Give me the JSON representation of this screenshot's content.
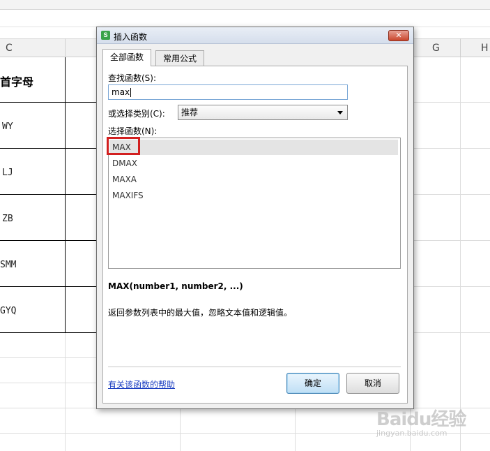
{
  "sheet": {
    "columns": [
      "C",
      "G",
      "H"
    ],
    "header_cell": "首字母",
    "rows": [
      "WY",
      "LJ",
      "ZB",
      "SMM",
      "GYQ"
    ]
  },
  "dialog": {
    "title": "插入函数",
    "app_icon": "S",
    "close_label": "✕",
    "tabs": [
      {
        "label": "全部函数",
        "active": true
      },
      {
        "label": "常用公式",
        "active": false
      }
    ],
    "search": {
      "label": "查找函数(S):",
      "value": "max"
    },
    "category": {
      "label": "或选择类别(C):",
      "value": "推荐"
    },
    "function_list": {
      "label": "选择函数(N):",
      "items": [
        "MAX",
        "DMAX",
        "MAXA",
        "MAXIFS"
      ],
      "selected": "MAX"
    },
    "signature": "MAX(number1, number2, ...)",
    "description": "返回参数列表中的最大值，忽略文本值和逻辑值。",
    "help_link": "有关该函数的帮助",
    "ok_label": "确定",
    "cancel_label": "取消"
  },
  "watermark": {
    "text": "Baidu经验",
    "url": "jingyan.baidu.com"
  },
  "colors": {
    "accent_highlight": "#d21f1f",
    "link": "#1a3dc1",
    "ok_border": "#3c7fb1"
  }
}
